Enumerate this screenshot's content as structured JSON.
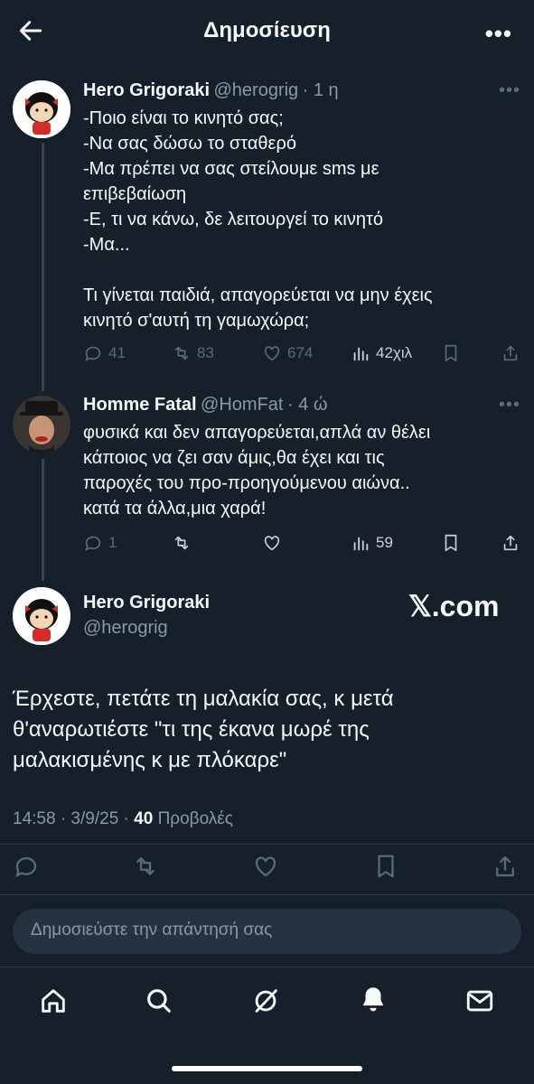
{
  "header": {
    "title": "Δημοσίευση"
  },
  "tweet1": {
    "name": "Hero Grigoraki",
    "handle": "@herogrig",
    "time": "· 1 η",
    "text": "-Ποιο είναι το κινητό σας;\n-Να σας δώσω το σταθερό\n-Μα πρέπει να σας στείλουμε sms με\nεπιβεβαίωση\n-Ε, τι να κάνω, δε λειτουργεί το κινητό\n-Μα...\n\nΤι γίνεται παιδιά, απαγορεύεται να μην έχεις\nκινητό σ'αυτή τη γαμωχώρα;",
    "replies": "41",
    "reposts": "83",
    "likes": "674",
    "views": "42χιλ"
  },
  "tweet2": {
    "name": "Homme Fatal",
    "handle": "@HomFat",
    "time": "· 4 ώ",
    "text": "φυσικά και δεν απαγορεύεται,απλά αν θέλει\nκάποιος να ζει σαν άμις,θα έχει και τις\nπαροχές του προ-προηγούμενου αιώνα..\nκατά τα άλλα,μια χαρά!",
    "replies": "1",
    "views": "59"
  },
  "main": {
    "name": "Hero Grigoraki",
    "handle": "@herogrig",
    "watermark": "𝕏.com",
    "text": "Έρχεστε, πετάτε τη μαλακία σας, κ μετά\nθ'αναρωτιέστε \"τι της έκανα μωρέ της\nμαλακισμένης κ με πλόκαρε\"",
    "timestamp": "14:58 · 3/9/25 · ",
    "views_count": "40",
    "views_label": " Προβολές"
  },
  "reply": {
    "placeholder": "Δημοσιεύστε την απάντησή σας"
  },
  "icons": [
    "back-arrow-icon",
    "more-icon",
    "reply-icon",
    "repost-icon",
    "like-icon",
    "views-icon",
    "bookmark-icon",
    "share-icon",
    "home-icon",
    "search-icon",
    "grok-icon",
    "notifications-icon",
    "messages-icon"
  ]
}
